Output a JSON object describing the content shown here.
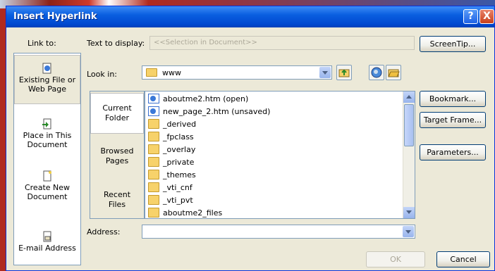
{
  "dialog": {
    "title": "Insert Hyperlink"
  },
  "titlebar": {
    "help": "?",
    "close": "X"
  },
  "link_to": {
    "label": "Link to:",
    "items": [
      {
        "label_line1": "Existing File or",
        "label_line2": "Web Page",
        "selected": true,
        "icon": "globe-page-icon"
      },
      {
        "label_line1": "Place in This",
        "label_line2": "Document",
        "selected": false,
        "icon": "document-place-icon"
      },
      {
        "label_line1": "Create New",
        "label_line2": "Document",
        "selected": false,
        "icon": "new-document-icon"
      },
      {
        "label_line1": "E-mail Address",
        "label_line2": "",
        "selected": false,
        "icon": "email-icon"
      }
    ]
  },
  "text_to_display": {
    "label": "Text to display:",
    "value": "<<Selection in Document>>"
  },
  "screentip_button": "ScreenTip...",
  "look_in": {
    "label": "Look in:",
    "value": "www"
  },
  "subtabs": [
    {
      "line1": "Current",
      "line2": "Folder",
      "selected": true
    },
    {
      "line1": "Browsed",
      "line2": "Pages",
      "selected": false
    },
    {
      "line1": "Recent",
      "line2": "Files",
      "selected": false
    }
  ],
  "files": [
    {
      "name": "aboutme2.htm (open)",
      "type": "page"
    },
    {
      "name": "new_page_2.htm (unsaved)",
      "type": "page"
    },
    {
      "name": "_derived",
      "type": "folder"
    },
    {
      "name": "_fpclass",
      "type": "folder"
    },
    {
      "name": "_overlay",
      "type": "folder"
    },
    {
      "name": "_private",
      "type": "folder"
    },
    {
      "name": "_themes",
      "type": "folder"
    },
    {
      "name": "_vti_cnf",
      "type": "folder"
    },
    {
      "name": "_vti_pvt",
      "type": "folder"
    },
    {
      "name": "aboutme2_files",
      "type": "folder"
    }
  ],
  "side_buttons": {
    "bookmark": "Bookmark...",
    "target_frame": "Target Frame...",
    "parameters": "Parameters..."
  },
  "address": {
    "label": "Address:",
    "value": ""
  },
  "ok_button": "OK",
  "cancel_button": "Cancel",
  "colors": {
    "title_blue": "#0a5fe0",
    "dialog_bg": "#ece9d8",
    "border": "#7f9db9"
  }
}
